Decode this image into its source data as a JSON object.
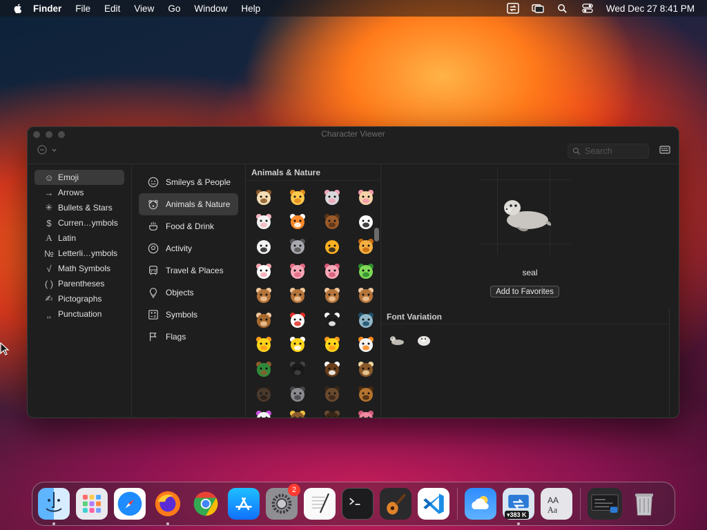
{
  "menubar": {
    "app": "Finder",
    "items": [
      "File",
      "Edit",
      "View",
      "Go",
      "Window",
      "Help"
    ],
    "clock": "Wed Dec 27  8:41 PM"
  },
  "window": {
    "title": "Character Viewer",
    "search_placeholder": "Search"
  },
  "categories": [
    {
      "label": "Emoji",
      "icon": "smiley-icon",
      "glyph": "☺",
      "selected": true
    },
    {
      "label": "Arrows",
      "icon": "arrow-icon",
      "glyph": "→",
      "selected": false
    },
    {
      "label": "Bullets & Stars",
      "icon": "asterisk-icon",
      "glyph": "✳",
      "selected": false
    },
    {
      "label": "Curren…ymbols",
      "icon": "dollar-icon",
      "glyph": "$",
      "selected": false
    },
    {
      "label": "Latin",
      "icon": "latin-a-icon",
      "glyph": "A",
      "selected": false
    },
    {
      "label": "Letterli…ymbols",
      "icon": "numero-icon",
      "glyph": "№",
      "selected": false
    },
    {
      "label": "Math Symbols",
      "icon": "sqrt-icon",
      "glyph": "√",
      "selected": false
    },
    {
      "label": "Parentheses",
      "icon": "parentheses-icon",
      "glyph": "( )",
      "selected": false
    },
    {
      "label": "Pictographs",
      "icon": "pictograph-icon",
      "glyph": "✍",
      "selected": false
    },
    {
      "label": "Punctuation",
      "icon": "punctuation-icon",
      "glyph": "‚,",
      "selected": false
    }
  ],
  "groups": [
    {
      "label": "Smileys & People",
      "icon": "smiley-icon",
      "selected": false
    },
    {
      "label": "Animals & Nature",
      "icon": "bear-icon",
      "selected": true
    },
    {
      "label": "Food & Drink",
      "icon": "food-icon",
      "selected": false
    },
    {
      "label": "Activity",
      "icon": "ball-icon",
      "selected": false
    },
    {
      "label": "Travel & Places",
      "icon": "bus-icon",
      "selected": false
    },
    {
      "label": "Objects",
      "icon": "lightbulb-icon",
      "selected": false
    },
    {
      "label": "Symbols",
      "icon": "symbols-icon",
      "selected": false
    },
    {
      "label": "Flags",
      "icon": "flag-icon",
      "selected": false
    }
  ],
  "grid": {
    "header": "Animals & Nature",
    "emojis": [
      "dog-face",
      "cat-face",
      "mouse-face",
      "hamster-face",
      "rabbit-face",
      "fox-face",
      "bear-face",
      "panda-face",
      "polar-bear",
      "koala",
      "tiger-face",
      "lion-face",
      "cow-face",
      "pig-face",
      "pig-nose",
      "frog-face",
      "monkey-face",
      "see-no-evil-monkey",
      "hear-no-evil-monkey",
      "speak-no-evil-monkey",
      "monkey",
      "chicken",
      "penguin",
      "bird",
      "baby-chick",
      "hatching-chick",
      "front-facing-chick",
      "goose",
      "duck",
      "black-bird",
      "eagle",
      "owl",
      "bat",
      "wolf",
      "boar",
      "horse-face",
      "unicorn",
      "bug",
      "ant",
      "worm"
    ]
  },
  "detail": {
    "name": "seal",
    "favorites_button": "Add to Favorites",
    "font_variation_header": "Font Variation",
    "variations": [
      "seal-photo-icon",
      "seal-cartoon-icon"
    ]
  },
  "dock": {
    "apps": [
      {
        "name": "finder",
        "running": true
      },
      {
        "name": "launchpad",
        "running": false
      },
      {
        "name": "safari",
        "running": false
      },
      {
        "name": "firefox",
        "running": true
      },
      {
        "name": "chrome",
        "running": false
      },
      {
        "name": "app-store",
        "running": false
      },
      {
        "name": "system-settings",
        "running": false,
        "badge": "2"
      },
      {
        "name": "textedit",
        "running": false
      },
      {
        "name": "terminal",
        "running": false
      },
      {
        "name": "garageband",
        "running": false
      },
      {
        "name": "vscode",
        "running": false
      }
    ],
    "extras": [
      {
        "name": "weather",
        "running": false
      },
      {
        "name": "network-monitor",
        "running": true,
        "label": "▾383 K"
      },
      {
        "name": "font-book",
        "running": false
      }
    ],
    "trash_label": "trash"
  }
}
